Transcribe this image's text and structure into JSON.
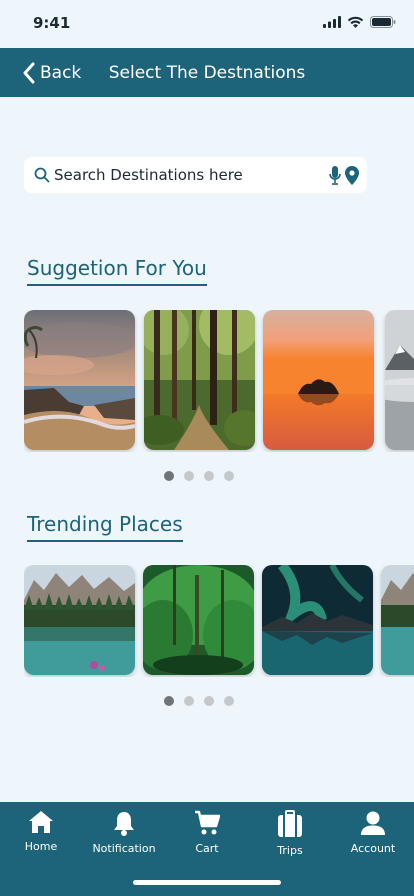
{
  "status": {
    "time": "9:41"
  },
  "nav": {
    "back_label": "Back",
    "title": "Select The Destnations"
  },
  "search": {
    "placeholder": "Search Destinations here",
    "value": ""
  },
  "sections": {
    "suggestions": {
      "title": "Suggetion For You",
      "page_count": 4,
      "active_page": 1
    },
    "trending": {
      "title": "Trending Places",
      "page_count": 4,
      "active_page": 1
    }
  },
  "tabs": [
    {
      "label": "Home",
      "icon": "home-icon"
    },
    {
      "label": "Notification",
      "icon": "bell-icon"
    },
    {
      "label": "Cart",
      "icon": "cart-icon"
    },
    {
      "label": "Trips",
      "icon": "suitcase-icon"
    },
    {
      "label": "Account",
      "icon": "person-icon"
    }
  ],
  "colors": {
    "primary": "#1d6379",
    "background": "#eef6fb"
  }
}
